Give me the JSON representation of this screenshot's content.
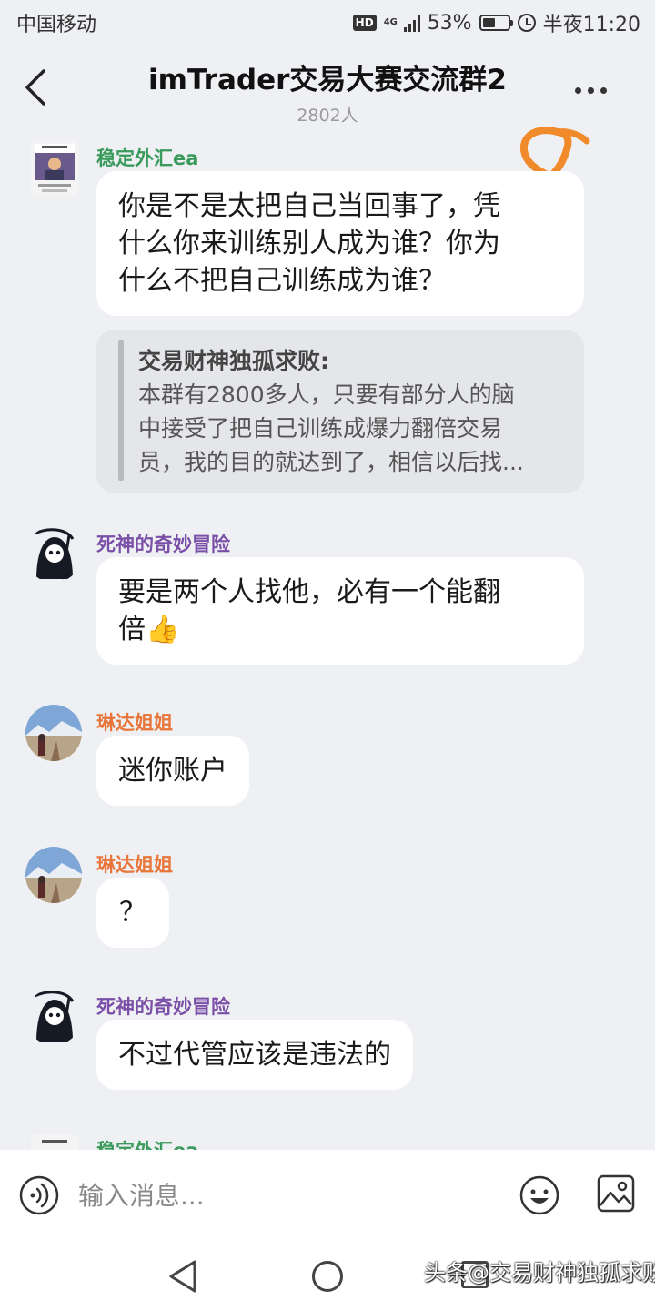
{
  "status_bar": {
    "carrier": "中国移动",
    "hd": "HD",
    "network": "4G",
    "battery": "53%",
    "battery_fraction": 0.53,
    "time": "半夜11:20"
  },
  "header": {
    "title": "imTrader交易大赛交流群2",
    "member_count": "2802人",
    "back_icon": "chevron-left-icon",
    "more_icon": "more-dots-icon",
    "annotation": "8",
    "annotation_color": "#f08a2a"
  },
  "messages": [
    {
      "sender": "稳定外汇ea",
      "sender_color": "#3a9a5c",
      "avatar": "avatar-stable-forex",
      "text": "你是不是太把自己当回事了，凭\n什么你来训练别人成为谁？你为\n什么不把自己训练成为谁？",
      "quote": {
        "author": "交易财神独孤求败:",
        "text": "本群有2800多人，只要有部分人的脑\n中接受了把自己训练成爆力翻倍交易\n员，我的目的就达到了，相信以后找..."
      }
    },
    {
      "sender": "死神的奇妙冒险",
      "sender_color": "#7a4fa8",
      "avatar": "avatar-reaper",
      "text": "要是两个人找他，必有一个能翻\n倍👍"
    },
    {
      "sender": "琳达姐姐",
      "sender_color": "#e8763a",
      "avatar": "avatar-linda",
      "text": "迷你账户"
    },
    {
      "sender": "琳达姐姐",
      "sender_color": "#e8763a",
      "avatar": "avatar-linda",
      "text": "？"
    },
    {
      "sender": "死神的奇妙冒险",
      "sender_color": "#7a4fa8",
      "avatar": "avatar-reaper",
      "text": "不过代管应该是违法的"
    },
    {
      "sender": "稳定外汇ea",
      "sender_color": "#3a9a5c",
      "avatar": "avatar-stable-forex"
    }
  ],
  "input_bar": {
    "placeholder": "输入消息...",
    "voice_icon": "voice-icon",
    "emoji_icon": "emoji-icon",
    "image_icon": "image-icon"
  },
  "nav_bar": {
    "back": "nav-back-icon",
    "home": "nav-home-icon",
    "recent": "nav-recent-icon"
  },
  "watermark": "头条@交易财神独孤求败"
}
